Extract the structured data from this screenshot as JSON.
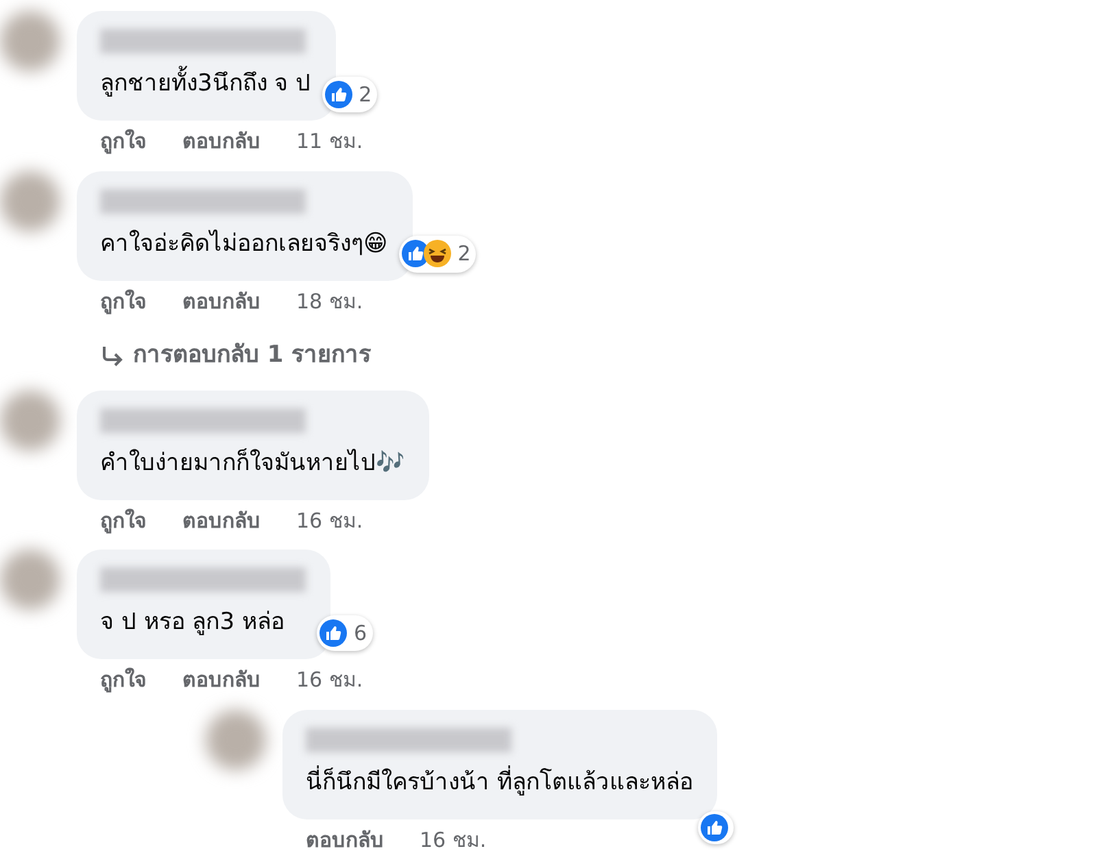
{
  "comments": [
    {
      "kind": "comment",
      "text": "ลูกชายทั้ง3นึกถึง จ ป",
      "reactions": [
        {
          "kind": "like"
        }
      ],
      "count": "2",
      "like": "ถูกใจ",
      "reply": "ตอบกลับ",
      "time": "11 ชม."
    },
    {
      "kind": "comment",
      "text": "คาใจอ่ะคิดไม่ออกเลยจริงๆ😁",
      "reactions": [
        {
          "kind": "like"
        },
        {
          "kind": "haha"
        }
      ],
      "count": "2",
      "like": "ถูกใจ",
      "reply": "ตอบกลับ",
      "time": "18 ชม.",
      "replies_link": "การตอบกลับ 1 รายการ"
    },
    {
      "kind": "comment",
      "text": "คำใบง่ายมากก็ใจมันหายไป🎶",
      "like": "ถูกใจ",
      "reply": "ตอบกลับ",
      "time": "16 ชม."
    },
    {
      "kind": "comment",
      "text": "จ ป หรอ ลูก3 หล่อ",
      "reactions": [
        {
          "kind": "like"
        }
      ],
      "count": "6",
      "like": "ถูกใจ",
      "reply": "ตอบกลับ",
      "time": "16 ชม."
    },
    {
      "kind": "reply",
      "text": "นี่ก็นึกมีใครบ้างน้า ที่ลูกโตแล้วและหล่อ",
      "reactions": [
        {
          "kind": "like"
        }
      ],
      "reply": "ตอบกลับ",
      "time": "16 ชม."
    }
  ]
}
